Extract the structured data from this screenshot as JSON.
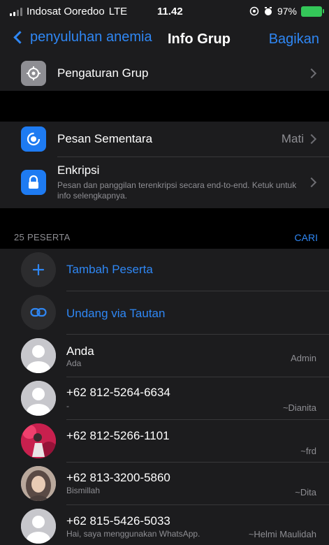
{
  "status_bar": {
    "carrier": "Indosat Ooredoo",
    "network": "LTE",
    "time": "11.42",
    "battery": "97%"
  },
  "nav": {
    "back_label": "penyuluhan anemia",
    "title": "Info Grup",
    "share_label": "Bagikan"
  },
  "settings": {
    "group_settings_label": "Pengaturan Grup",
    "disappearing_label": "Pesan Sementara",
    "disappearing_value": "Mati",
    "encryption_label": "Enkripsi",
    "encryption_desc": "Pesan dan panggilan terenkripsi secara end-to-end. Ketuk untuk info selengkapnya."
  },
  "participants": {
    "header": "25 PESERTA",
    "search_label": "CARI",
    "add_label": "Tambah Peserta",
    "invite_label": "Undang via Tautan",
    "members": [
      {
        "name": "Anda",
        "status": "Ada",
        "role": "Admin"
      },
      {
        "name": "+62 812-5264-6634",
        "status": "-",
        "role": "~Dianita"
      },
      {
        "name": "+62 812-5266-1101",
        "status": "",
        "role": "~frd"
      },
      {
        "name": "+62 813-3200-5860",
        "status": "Bismillah",
        "role": "~Dita"
      },
      {
        "name": "+62 815-5426-5033",
        "status": "Hai, saya menggunakan WhatsApp.",
        "role": "~Helmi Maulidah"
      }
    ]
  },
  "colors": {
    "accent": "#2f87f4",
    "background": "#000000",
    "cell": "#1c1c1e",
    "secondary_text": "#8e8e93"
  }
}
